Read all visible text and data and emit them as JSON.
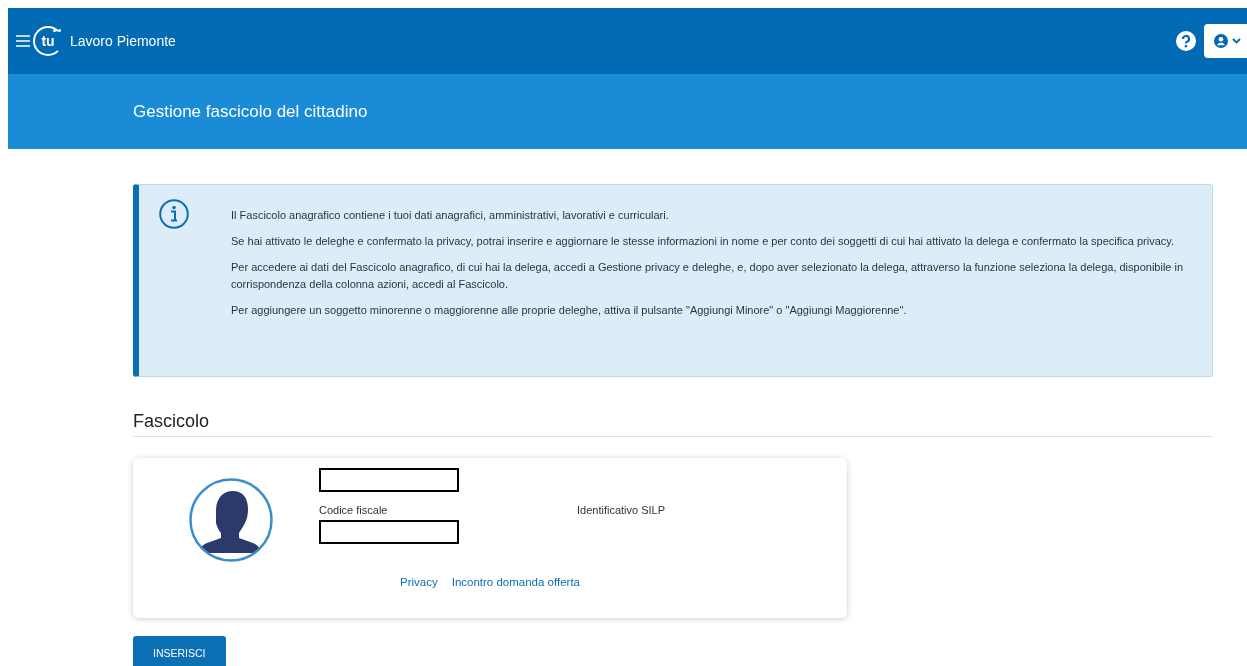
{
  "header": {
    "logo_text": "tu",
    "app_name": "Lavoro Piemonte"
  },
  "page_title": "Gestione fascicolo del cittadino",
  "info": {
    "paragraphs": [
      "Il Fascicolo anagrafico contiene i tuoi dati anagrafici, amministrativi, lavorativi e curriculari.",
      "Se hai attivato le deleghe e confermato la privacy, potrai inserire e aggiornare le stesse informazioni in nome e per conto dei soggetti di cui hai attivato la delega e confermato la specifica privacy.",
      "Per accedere ai dati del Fascicolo anagrafico, di cui hai la delega, accedi a Gestione privacy e deleghe, e, dopo aver selezionato la delega, attraverso la funzione seleziona la delega, disponibile in corrispondenza della colonna azioni, accedi al Fascicolo.",
      "Per aggiungere un soggetto minorenne o maggiorenne alle proprie deleghe, attiva il pulsante \"Aggiungi Minore\" o \"Aggiungi Maggiorenne\"."
    ]
  },
  "section_title": "Fascicolo",
  "card": {
    "fields": [
      {
        "label": "Codice fiscale"
      },
      {
        "label": "Identificativo SILP"
      }
    ],
    "links": [
      "Privacy",
      "Incontro domanda offerta"
    ]
  },
  "buttons": [
    "INSERISCI"
  ]
}
